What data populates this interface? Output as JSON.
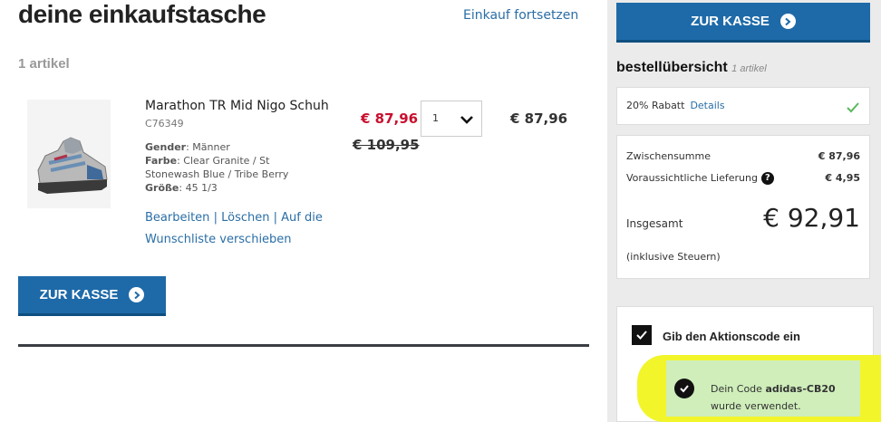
{
  "header": {
    "title": "deine einkaufstasche",
    "continue_label": "Einkauf fortsetzen",
    "item_count": "1 artikel"
  },
  "product": {
    "name": "Marathon TR Mid Nigo Schuh",
    "sku": "C76349",
    "gender_label": "Gender",
    "gender": "Männer",
    "color_label": "Farbe",
    "color": "Clear Granite / St Stonewash Blue / Tribe Berry",
    "size_label": "Größe",
    "size": "45 1/3",
    "edit_label": "Bearbeiten",
    "delete_label": "Löschen",
    "wishlist_label": "Auf die Wunschliste verschieben",
    "price_sale": "€ 87,96",
    "price_old": "€ 109,95",
    "quantity": "1",
    "line_total": "€ 87,96",
    "image_icon": "sneaker-icon"
  },
  "checkout": {
    "label": "ZUR KASSE",
    "icon": "arrow-right-circle-icon"
  },
  "summary": {
    "title": "bestellübersicht",
    "count": "1 artikel",
    "discount_label": "20% Rabatt",
    "discount_details": "Details",
    "subtotal_label": "Zwischensumme",
    "subtotal": "€ 87,96",
    "shipping_label": "Voraussichtliche Lieferung",
    "shipping": "€ 4,95",
    "total_label": "Insgesamt",
    "total": "€ 92,91",
    "tax_note": "(inklusive Steuern)"
  },
  "promo": {
    "label": "Gib den Aktionscode ein",
    "success_prefix": "Dein Code",
    "code": "adidas-CB20",
    "success_suffix": "wurde verwendet."
  },
  "colors": {
    "accent": "#1e6aa8",
    "sale": "#c8102e",
    "success_bg": "#cfeeba",
    "highlight": "#f2f52a"
  }
}
